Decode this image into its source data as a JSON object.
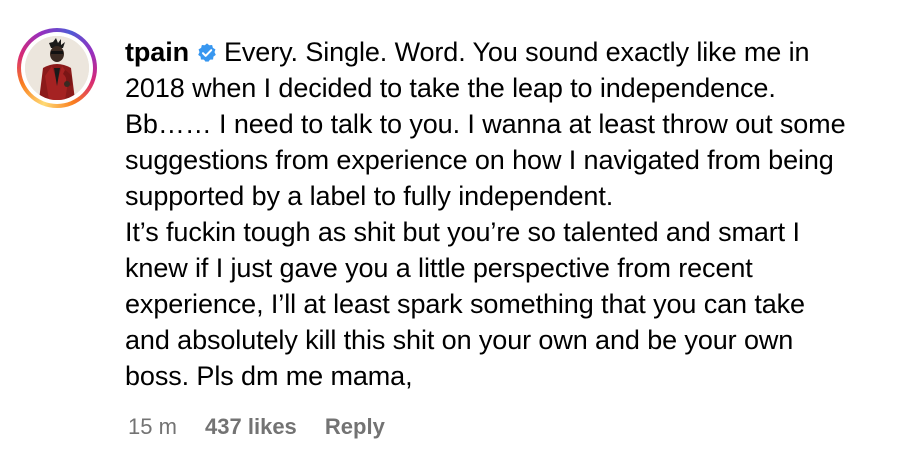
{
  "comment": {
    "username": "tpain",
    "verified": true,
    "text": "Every. Single. Word. You sound exactly like me in\n2018 when I decided to take the leap to independence.\nBb…… I need to talk to you. I wanna at least throw out some\nsuggestions from experience on how I navigated from being\nsupported by a label to fully independent.\nIt’s fuckin tough as shit but you’re so talented and smart I\nknew if I just gave you a little perspective from recent\nexperience, I’ll at least spark something that you can take\nand absolutely kill this shit on your own and be your own\nboss. Pls dm me mama,",
    "time": "15 m",
    "likes": "437 likes",
    "reply_label": "Reply"
  },
  "colors": {
    "verified_badge": "#3897f0",
    "meta_text": "#737373",
    "ring_gradient": [
      "#feda75",
      "#fa7e1e",
      "#d62976",
      "#962fbf",
      "#4f5bd5"
    ]
  },
  "icons": {
    "verified": "verified-badge-icon",
    "avatar": "user-avatar"
  }
}
